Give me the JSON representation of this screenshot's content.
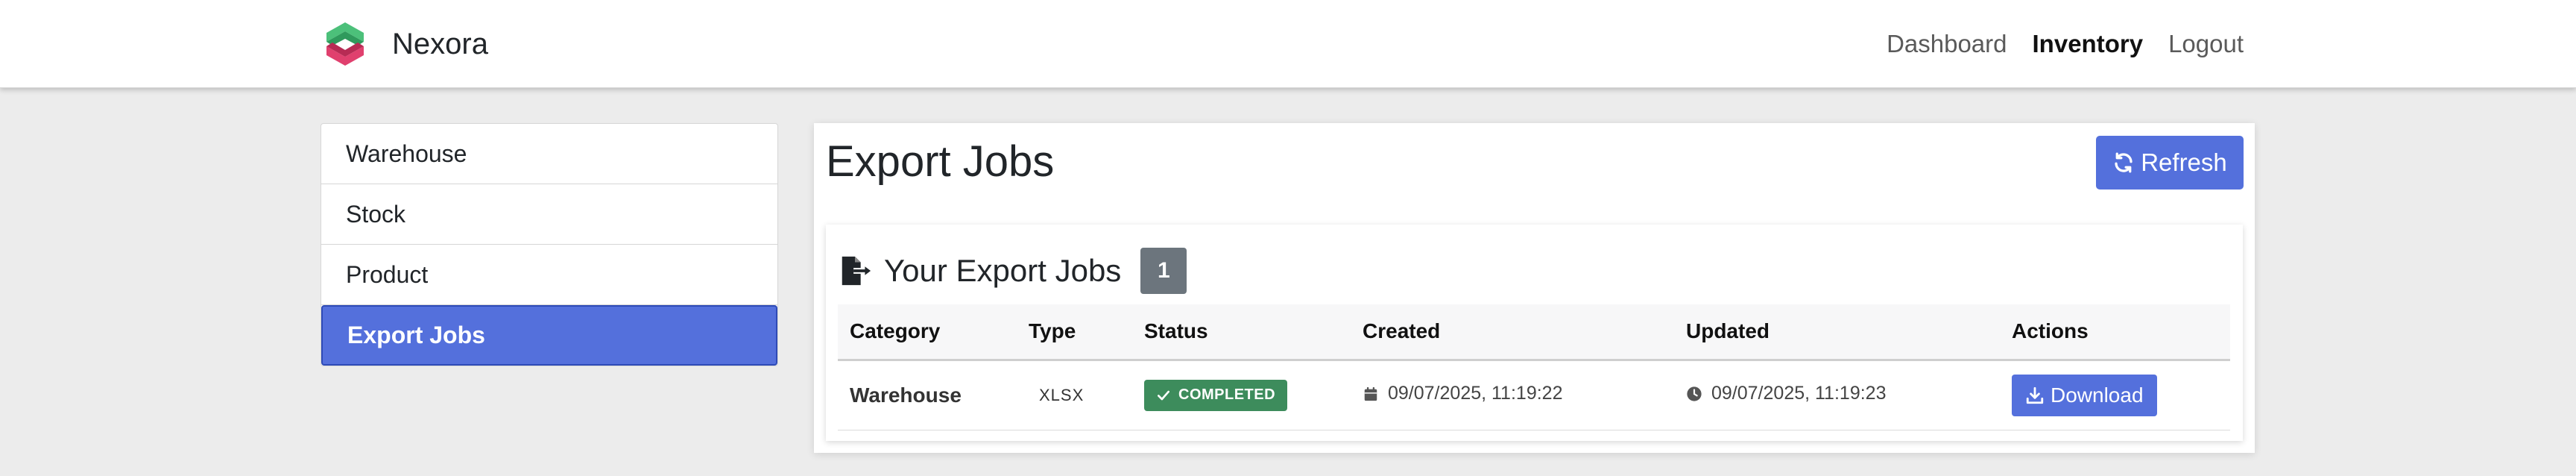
{
  "brand": {
    "name": "Nexora",
    "logo_icon": "nexora-logo-icon"
  },
  "nav": [
    {
      "label": "Dashboard",
      "active": false
    },
    {
      "label": "Inventory",
      "active": true
    },
    {
      "label": "Logout",
      "active": false
    }
  ],
  "sidebar": {
    "items": [
      {
        "label": "Warehouse",
        "active": false
      },
      {
        "label": "Stock",
        "active": false
      },
      {
        "label": "Product",
        "active": false
      },
      {
        "label": "Export Jobs",
        "active": true
      }
    ]
  },
  "main": {
    "title": "Export Jobs",
    "refresh_label": "Refresh",
    "refresh_icon": "refresh-icon"
  },
  "jobs_panel": {
    "title": "Your Export Jobs",
    "count": "1",
    "icon": "file-export-icon",
    "columns": [
      "Category",
      "Type",
      "Status",
      "Created",
      "Updated",
      "Actions"
    ],
    "rows": [
      {
        "category": "Warehouse",
        "type": "XLSX",
        "status": "COMPLETED",
        "created": "09/07/2025, 11:19:22",
        "updated": "09/07/2025, 11:19:23",
        "action_label": "Download"
      }
    ]
  },
  "colors": {
    "accent": "#5470dc",
    "success": "#3d8c5c",
    "badge_gray": "#6c757d"
  }
}
